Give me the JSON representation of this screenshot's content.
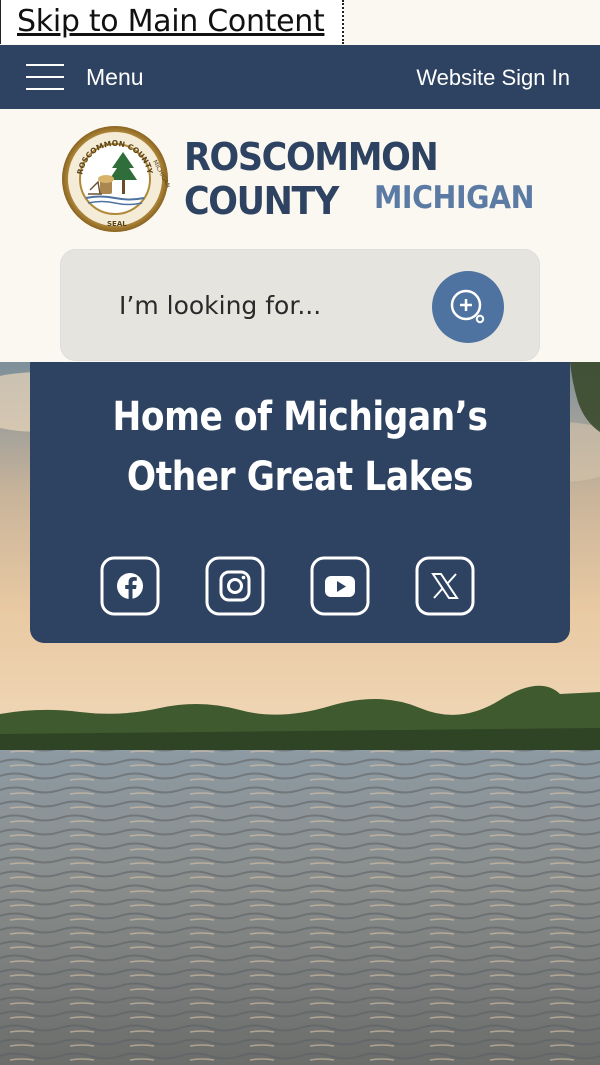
{
  "skip_link": {
    "label": "Skip to Main Content"
  },
  "topbar": {
    "menu_label": "Menu",
    "sign_in_label": "Website Sign In",
    "bg_color": "#2e4261"
  },
  "header": {
    "brand_line1": "ROSCOMMON COUNTY",
    "brand_line2": "MICHIGAN",
    "seal_text_top": "ROSCOMMON COUNTY",
    "seal_text_right": "MICHIGAN",
    "seal_text_bottom": "SEAL"
  },
  "search": {
    "placeholder": "I’m looking for...",
    "button_icon": "search-plus-icon"
  },
  "hero": {
    "tagline_line1": "Home of Michigan’s",
    "tagline_line2": "Other Great Lakes",
    "social": [
      {
        "name": "facebook-icon"
      },
      {
        "name": "instagram-icon"
      },
      {
        "name": "youtube-icon"
      },
      {
        "name": "x-icon"
      }
    ]
  },
  "colors": {
    "navy": "#2e4261",
    "accent_blue": "#4f73a0",
    "cream": "#fbf8f1"
  }
}
